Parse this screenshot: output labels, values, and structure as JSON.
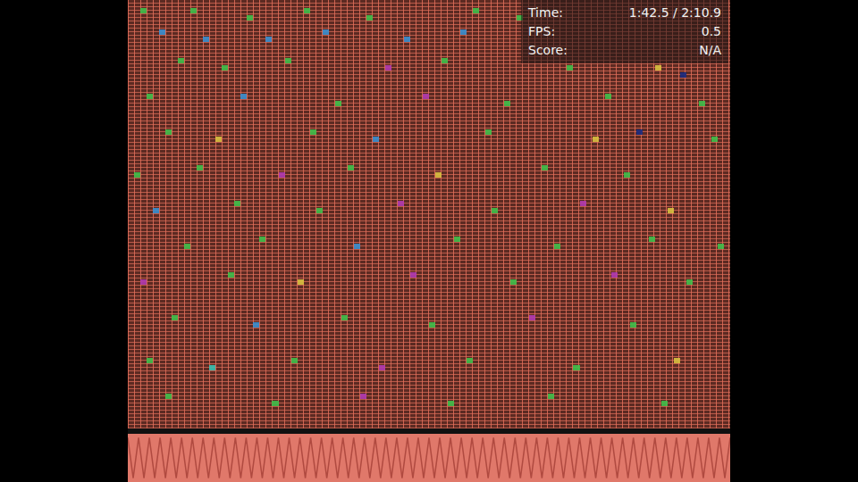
{
  "hud": [
    {
      "label": "Time:",
      "value": "1:42.5 / 2:10.9"
    },
    {
      "label": "FPS:",
      "value": "0.5"
    },
    {
      "label": "Score:",
      "value": "N/A"
    }
  ],
  "notes": [
    {
      "lane": 2,
      "row": 1,
      "color": "#3fbf4a"
    },
    {
      "lane": 10,
      "row": 1,
      "color": "#3fbf4a"
    },
    {
      "lane": 19,
      "row": 2,
      "color": "#3fbf4a"
    },
    {
      "lane": 28,
      "row": 1,
      "color": "#3fbf4a"
    },
    {
      "lane": 38,
      "row": 2,
      "color": "#3fbf4a"
    },
    {
      "lane": 55,
      "row": 1,
      "color": "#3fbf4a"
    },
    {
      "lane": 62,
      "row": 2,
      "color": "#3fbf4a"
    },
    {
      "lane": 5,
      "row": 4,
      "color": "#3a8fd0"
    },
    {
      "lane": 12,
      "row": 5,
      "color": "#3a8fd0"
    },
    {
      "lane": 22,
      "row": 5,
      "color": "#3a8fd0"
    },
    {
      "lane": 31,
      "row": 4,
      "color": "#3a8fd0"
    },
    {
      "lane": 44,
      "row": 5,
      "color": "#3a8fd0"
    },
    {
      "lane": 53,
      "row": 4,
      "color": "#3a8fd0"
    },
    {
      "lane": 8,
      "row": 8,
      "color": "#3fbf4a"
    },
    {
      "lane": 15,
      "row": 9,
      "color": "#3fbf4a"
    },
    {
      "lane": 25,
      "row": 8,
      "color": "#3fbf4a"
    },
    {
      "lane": 41,
      "row": 9,
      "color": "#b03ab0"
    },
    {
      "lane": 50,
      "row": 8,
      "color": "#3fbf4a"
    },
    {
      "lane": 70,
      "row": 9,
      "color": "#3fbf4a"
    },
    {
      "lane": 84,
      "row": 9,
      "color": "#d8c040"
    },
    {
      "lane": 88,
      "row": 10,
      "color": "#1a2a80"
    },
    {
      "lane": 3,
      "row": 13,
      "color": "#3fbf4a"
    },
    {
      "lane": 18,
      "row": 13,
      "color": "#3a8fd0"
    },
    {
      "lane": 33,
      "row": 14,
      "color": "#3fbf4a"
    },
    {
      "lane": 47,
      "row": 13,
      "color": "#b03ab0"
    },
    {
      "lane": 60,
      "row": 14,
      "color": "#3fbf4a"
    },
    {
      "lane": 76,
      "row": 13,
      "color": "#3fbf4a"
    },
    {
      "lane": 91,
      "row": 14,
      "color": "#3fbf4a"
    },
    {
      "lane": 6,
      "row": 18,
      "color": "#3fbf4a"
    },
    {
      "lane": 14,
      "row": 19,
      "color": "#d8c040"
    },
    {
      "lane": 29,
      "row": 18,
      "color": "#3fbf4a"
    },
    {
      "lane": 39,
      "row": 19,
      "color": "#3a8fd0"
    },
    {
      "lane": 57,
      "row": 18,
      "color": "#3fbf4a"
    },
    {
      "lane": 74,
      "row": 19,
      "color": "#d8c040"
    },
    {
      "lane": 81,
      "row": 18,
      "color": "#1a2a80"
    },
    {
      "lane": 93,
      "row": 19,
      "color": "#3fbf4a"
    },
    {
      "lane": 1,
      "row": 24,
      "color": "#3fbf4a"
    },
    {
      "lane": 11,
      "row": 23,
      "color": "#3fbf4a"
    },
    {
      "lane": 24,
      "row": 24,
      "color": "#b03ab0"
    },
    {
      "lane": 35,
      "row": 23,
      "color": "#3fbf4a"
    },
    {
      "lane": 49,
      "row": 24,
      "color": "#d8c040"
    },
    {
      "lane": 66,
      "row": 23,
      "color": "#3fbf4a"
    },
    {
      "lane": 79,
      "row": 24,
      "color": "#3fbf4a"
    },
    {
      "lane": 4,
      "row": 29,
      "color": "#3a8fd0"
    },
    {
      "lane": 17,
      "row": 28,
      "color": "#3fbf4a"
    },
    {
      "lane": 30,
      "row": 29,
      "color": "#3fbf4a"
    },
    {
      "lane": 43,
      "row": 28,
      "color": "#b03ab0"
    },
    {
      "lane": 58,
      "row": 29,
      "color": "#3fbf4a"
    },
    {
      "lane": 72,
      "row": 28,
      "color": "#b03ab0"
    },
    {
      "lane": 86,
      "row": 29,
      "color": "#d8c040"
    },
    {
      "lane": 9,
      "row": 34,
      "color": "#3fbf4a"
    },
    {
      "lane": 21,
      "row": 33,
      "color": "#3fbf4a"
    },
    {
      "lane": 36,
      "row": 34,
      "color": "#3a8fd0"
    },
    {
      "lane": 52,
      "row": 33,
      "color": "#3fbf4a"
    },
    {
      "lane": 68,
      "row": 34,
      "color": "#3fbf4a"
    },
    {
      "lane": 83,
      "row": 33,
      "color": "#3fbf4a"
    },
    {
      "lane": 94,
      "row": 34,
      "color": "#3fbf4a"
    },
    {
      "lane": 2,
      "row": 39,
      "color": "#b03ab0"
    },
    {
      "lane": 16,
      "row": 38,
      "color": "#3fbf4a"
    },
    {
      "lane": 27,
      "row": 39,
      "color": "#d8c040"
    },
    {
      "lane": 45,
      "row": 38,
      "color": "#b03ab0"
    },
    {
      "lane": 61,
      "row": 39,
      "color": "#3fbf4a"
    },
    {
      "lane": 77,
      "row": 38,
      "color": "#b03ab0"
    },
    {
      "lane": 89,
      "row": 39,
      "color": "#3fbf4a"
    },
    {
      "lane": 7,
      "row": 44,
      "color": "#3fbf4a"
    },
    {
      "lane": 20,
      "row": 45,
      "color": "#3a8fd0"
    },
    {
      "lane": 34,
      "row": 44,
      "color": "#3fbf4a"
    },
    {
      "lane": 48,
      "row": 45,
      "color": "#3fbf4a"
    },
    {
      "lane": 64,
      "row": 44,
      "color": "#b03ab0"
    },
    {
      "lane": 80,
      "row": 45,
      "color": "#3fbf4a"
    },
    {
      "lane": 3,
      "row": 50,
      "color": "#3fbf4a"
    },
    {
      "lane": 13,
      "row": 51,
      "color": "#3ac0b0"
    },
    {
      "lane": 26,
      "row": 50,
      "color": "#3fbf4a"
    },
    {
      "lane": 40,
      "row": 51,
      "color": "#b03ab0"
    },
    {
      "lane": 54,
      "row": 50,
      "color": "#3fbf4a"
    },
    {
      "lane": 71,
      "row": 51,
      "color": "#3fbf4a"
    },
    {
      "lane": 87,
      "row": 50,
      "color": "#d8c040"
    },
    {
      "lane": 6,
      "row": 55,
      "color": "#3fbf4a"
    },
    {
      "lane": 23,
      "row": 56,
      "color": "#3fbf4a"
    },
    {
      "lane": 37,
      "row": 55,
      "color": "#b03ab0"
    },
    {
      "lane": 51,
      "row": 56,
      "color": "#3fbf4a"
    },
    {
      "lane": 67,
      "row": 55,
      "color": "#3fbf4a"
    },
    {
      "lane": 85,
      "row": 56,
      "color": "#3fbf4a"
    }
  ]
}
